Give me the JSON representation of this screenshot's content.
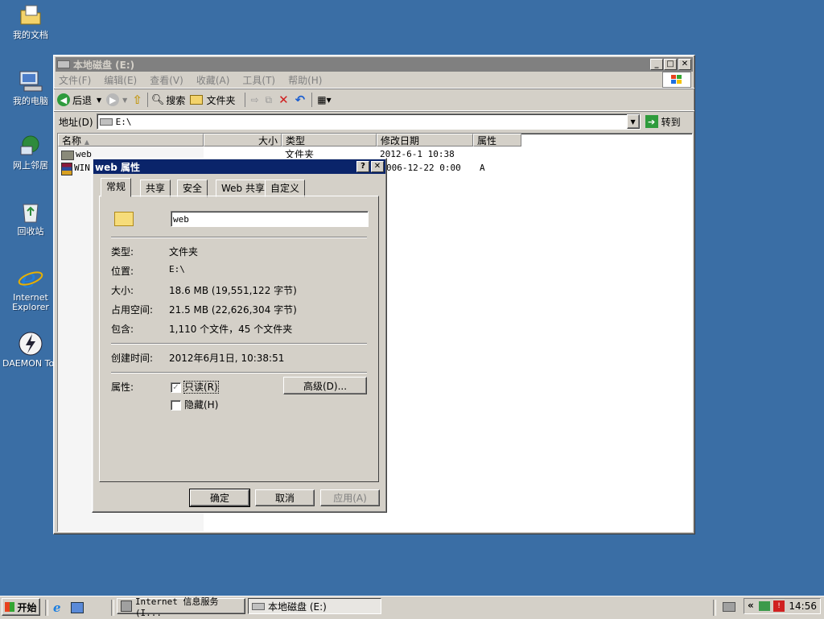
{
  "desktop": {
    "icons": [
      {
        "label": "我的文档",
        "icon": "my-documents-icon"
      },
      {
        "label": "我的电脑",
        "icon": "my-computer-icon"
      },
      {
        "label": "网上邻居",
        "icon": "network-icon"
      },
      {
        "label": "回收站",
        "icon": "recycle-bin-icon"
      },
      {
        "label": "Internet Explorer",
        "icon": "ie-icon"
      },
      {
        "label": "DAEMON Tool",
        "icon": "daemon-tools-icon"
      }
    ]
  },
  "explorer": {
    "title": "本地磁盘 (E:)",
    "menu": [
      "文件(F)",
      "编辑(E)",
      "查看(V)",
      "收藏(A)",
      "工具(T)",
      "帮助(H)"
    ],
    "toolbar": {
      "back": "后退",
      "search": "搜索",
      "folders": "文件夹"
    },
    "address": {
      "label": "地址(D)",
      "value": "E:\\",
      "go": "转到"
    },
    "columns": [
      "名称",
      "大小",
      "类型",
      "修改日期",
      "属性"
    ],
    "files": [
      {
        "name": "web",
        "size": "",
        "type": "文件夹",
        "modified": "2012-6-1 10:38",
        "attr": ""
      },
      {
        "name": "WIN",
        "size": "",
        "type": "",
        "modified": "006-12-22 0:00",
        "attr": "A"
      }
    ]
  },
  "props": {
    "title": "web 属性",
    "tabs": [
      "常规",
      "共享",
      "安全",
      "Web 共享",
      "自定义"
    ],
    "name_value": "web",
    "rows": {
      "type_k": "类型:",
      "type_v": "文件夹",
      "loc_k": "位置:",
      "loc_v": "E:\\",
      "size_k": "大小:",
      "size_v": "18.6 MB (19,551,122 字节)",
      "disk_k": "占用空间:",
      "disk_v": "21.5 MB (22,626,304 字节)",
      "contains_k": "包含:",
      "contains_v": "1,110 个文件，45 个文件夹",
      "created_k": "创建时间:",
      "created_v": "2012年6月1日, 10:38:51",
      "attr_k": "属性:"
    },
    "readonly": "只读(R)",
    "hidden": "隐藏(H)",
    "advanced": "高级(D)...",
    "ok": "确定",
    "cancel": "取消",
    "apply": "应用(A)"
  },
  "taskbar": {
    "start": "开始",
    "tasks": [
      "Internet 信息服务(I...",
      "本地磁盘 (E:)"
    ],
    "clock": "14:56",
    "tray_chevron": "«"
  }
}
